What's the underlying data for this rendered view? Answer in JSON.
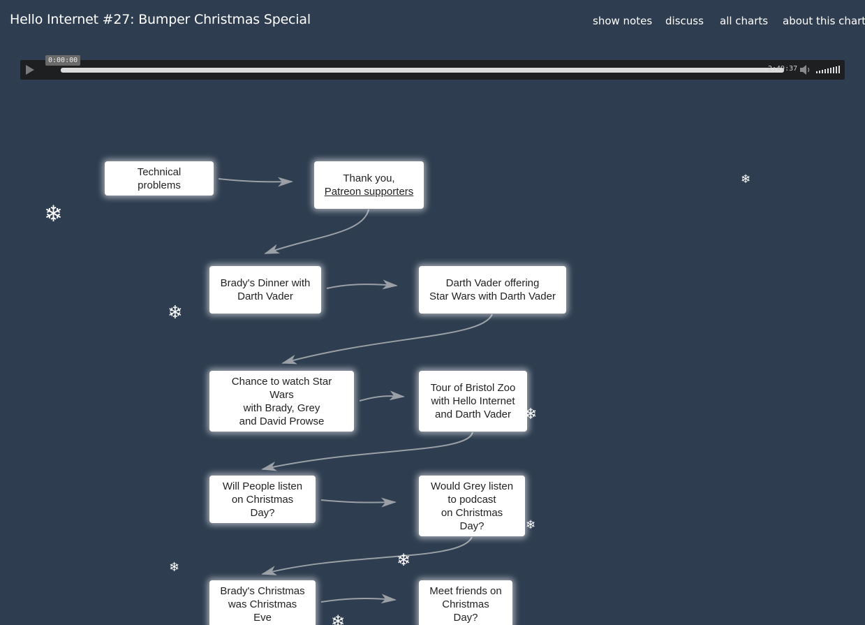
{
  "header": {
    "title": "Hello Internet #27: Bumper Christmas Special",
    "nav": [
      "show notes",
      "discuss",
      "all charts",
      "about this chart"
    ]
  },
  "player": {
    "current_time": "0:00:00",
    "duration": "2:49:37",
    "progress": 0,
    "volume_level": 1.0
  },
  "flowchart": {
    "nodes": [
      {
        "label": "Technical problems"
      },
      {
        "label": "Thank you,",
        "link": "Patreon supporters"
      },
      {
        "label": "Brady's Dinner with\nDarth Vader"
      },
      {
        "label": "Darth Vader offering\nStar Wars with Darth Vader"
      },
      {
        "label": "Chance to watch Star Wars\nwith Brady, Grey\nand David Prowse"
      },
      {
        "label": "Tour of Bristol Zoo\nwith Hello Internet\nand Darth Vader"
      },
      {
        "label": "Will People listen\non Christmas Day?"
      },
      {
        "label": "Would Grey listen\nto podcast\non Christmas Day?"
      },
      {
        "label": "Brady's Christmas\nwas Christmas Eve"
      },
      {
        "label": "Meet friends on\nChristmas Day?"
      }
    ]
  },
  "colors": {
    "background": "#2e3d50",
    "node_fill": "#ffffff",
    "edge": "#9aa0a6",
    "player_bg": "#1e1f21"
  },
  "icons": {
    "play": "play-icon",
    "volume": "speaker-icon",
    "snowflake": "snowflake-icon"
  }
}
